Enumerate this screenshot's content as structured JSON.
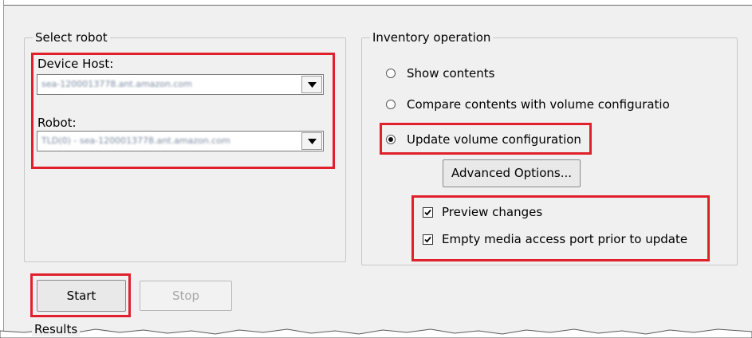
{
  "select_robot": {
    "title": "Select robot",
    "device_host_label": "Device Host:",
    "device_host_value": "sea-1200013778.ant.amazon.com",
    "robot_label": "Robot:",
    "robot_value": "TLD(0) - sea-1200013778.ant.amazon.com"
  },
  "inventory": {
    "title": "Inventory operation",
    "options": [
      {
        "label": "Show contents",
        "selected": false
      },
      {
        "label": "Compare contents with volume configuratio",
        "selected": false
      },
      {
        "label": "Update volume configuration",
        "selected": true
      }
    ],
    "advanced_button": "Advanced Options...",
    "checkboxes": [
      {
        "label": "Preview changes",
        "checked": true
      },
      {
        "label": "Empty media access port prior to update",
        "checked": true
      }
    ]
  },
  "actions": {
    "start": "Start",
    "stop": "Stop"
  },
  "results_label": "Results",
  "highlight_color": "#e0202b"
}
